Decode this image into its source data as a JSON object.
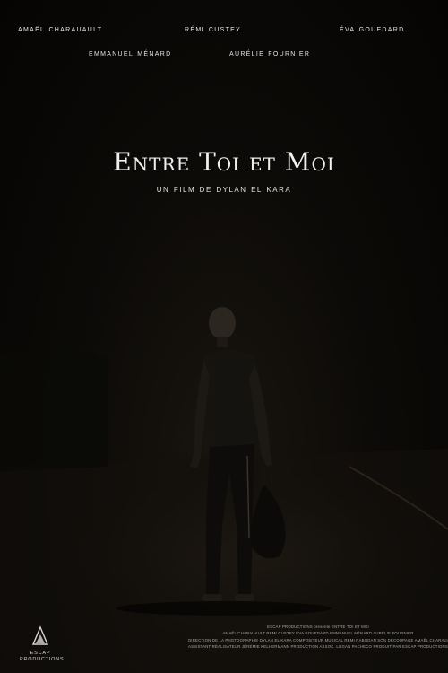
{
  "cast": {
    "row1": [
      "amaël CHARAUAULT",
      "rémi CUSTEY",
      "éva GOUEDARD"
    ],
    "row2": [
      "emmanuel MÉNARD",
      "aurélie FOURNIER"
    ]
  },
  "title": "Entre Toi et Moi",
  "subtitle": "un film de DYLAN EL KARA",
  "credits": [
    "ESCAP PRODUCTIONS présente ENTRE TOI ET MOI",
    "AMAËL CHARAUAULT   RÉMI CUSTEY   ÉVA GOUEDARD   EMMANUEL MÉNARD   AURÉLIE FOURNIER",
    "DIRECTION DE LA PHOTOGRAPHIE DYLAN EL KARA   COMPOSITEUR MUSICAL RÉMI RABODAN   SON DÉCOUPAGE AMAËL CHARAUAULT   MIXE & DESIGN DE SONS DENIS REPERSIM",
    "ASSISTANT RÉALISATEUR JÉRÉMIE KELHERMANN   PRODUCTION ASSOC. LOGAN PACHECO   PRODUIT PAR ESCAP PRODUCTIONS   SCÉNARIO ALBAN JAMES   RÉALISÉ PAR DYLAN EL KARA"
  ],
  "logo": {
    "line1": "ESCAP",
    "line2": "PRODUCTIONS"
  },
  "colors": {
    "background": "#050403",
    "text": "#e8e8e8"
  }
}
